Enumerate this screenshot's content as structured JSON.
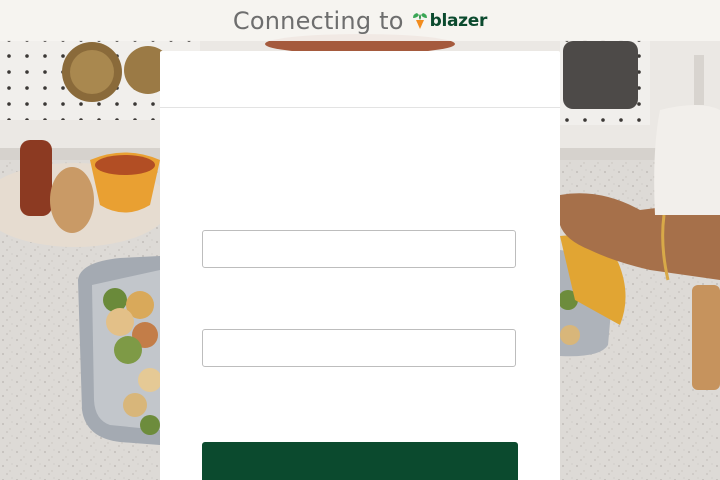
{
  "header": {
    "connecting_text": "Connecting to",
    "brand_name": "blazer",
    "brand_icon": "sprout-icon"
  },
  "form": {
    "field_1_value": "",
    "field_2_value": "",
    "submit_label": ""
  },
  "colors": {
    "brand": "#0b4a2e",
    "header_text": "#6e6e6e",
    "card_bg": "#ffffff",
    "input_border": "#bdbdbd"
  }
}
